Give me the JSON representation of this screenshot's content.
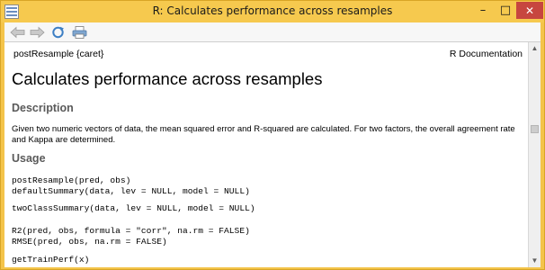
{
  "window": {
    "title": "R: Calculates performance across resamples",
    "min_glyph": "–",
    "max_glyph": "□",
    "close_glyph": "✕"
  },
  "toolbar": {
    "icons": [
      "back-arrow-icon",
      "forward-arrow-icon",
      "refresh-icon",
      "print-icon"
    ]
  },
  "doc": {
    "topic": "postResample {caret}",
    "doc_label": "R Documentation",
    "title": "Calculates performance across resamples",
    "description_heading": "Description",
    "description": "Given two numeric vectors of data, the mean squared error and R-squared are calculated. For two factors, the overall agreement rate and Kappa are determined.",
    "usage_heading": "Usage",
    "usage": {
      "block1": "postResample(pred, obs)\ndefaultSummary(data, lev = NULL, model = NULL)",
      "block2": "twoClassSummary(data, lev = NULL, model = NULL)",
      "block3": "R2(pred, obs, formula = \"corr\", na.rm = FALSE)\nRMSE(pred, obs, na.rm = FALSE)",
      "block4": "getTrainPerf(x)"
    }
  },
  "scrollbar": {
    "up_glyph": "▲",
    "down_glyph": "▼",
    "position_fraction": 0.3
  },
  "colors": {
    "titlebar": "#f6c94e",
    "close_button": "#c7463f",
    "heading": "#5a5a5a"
  }
}
